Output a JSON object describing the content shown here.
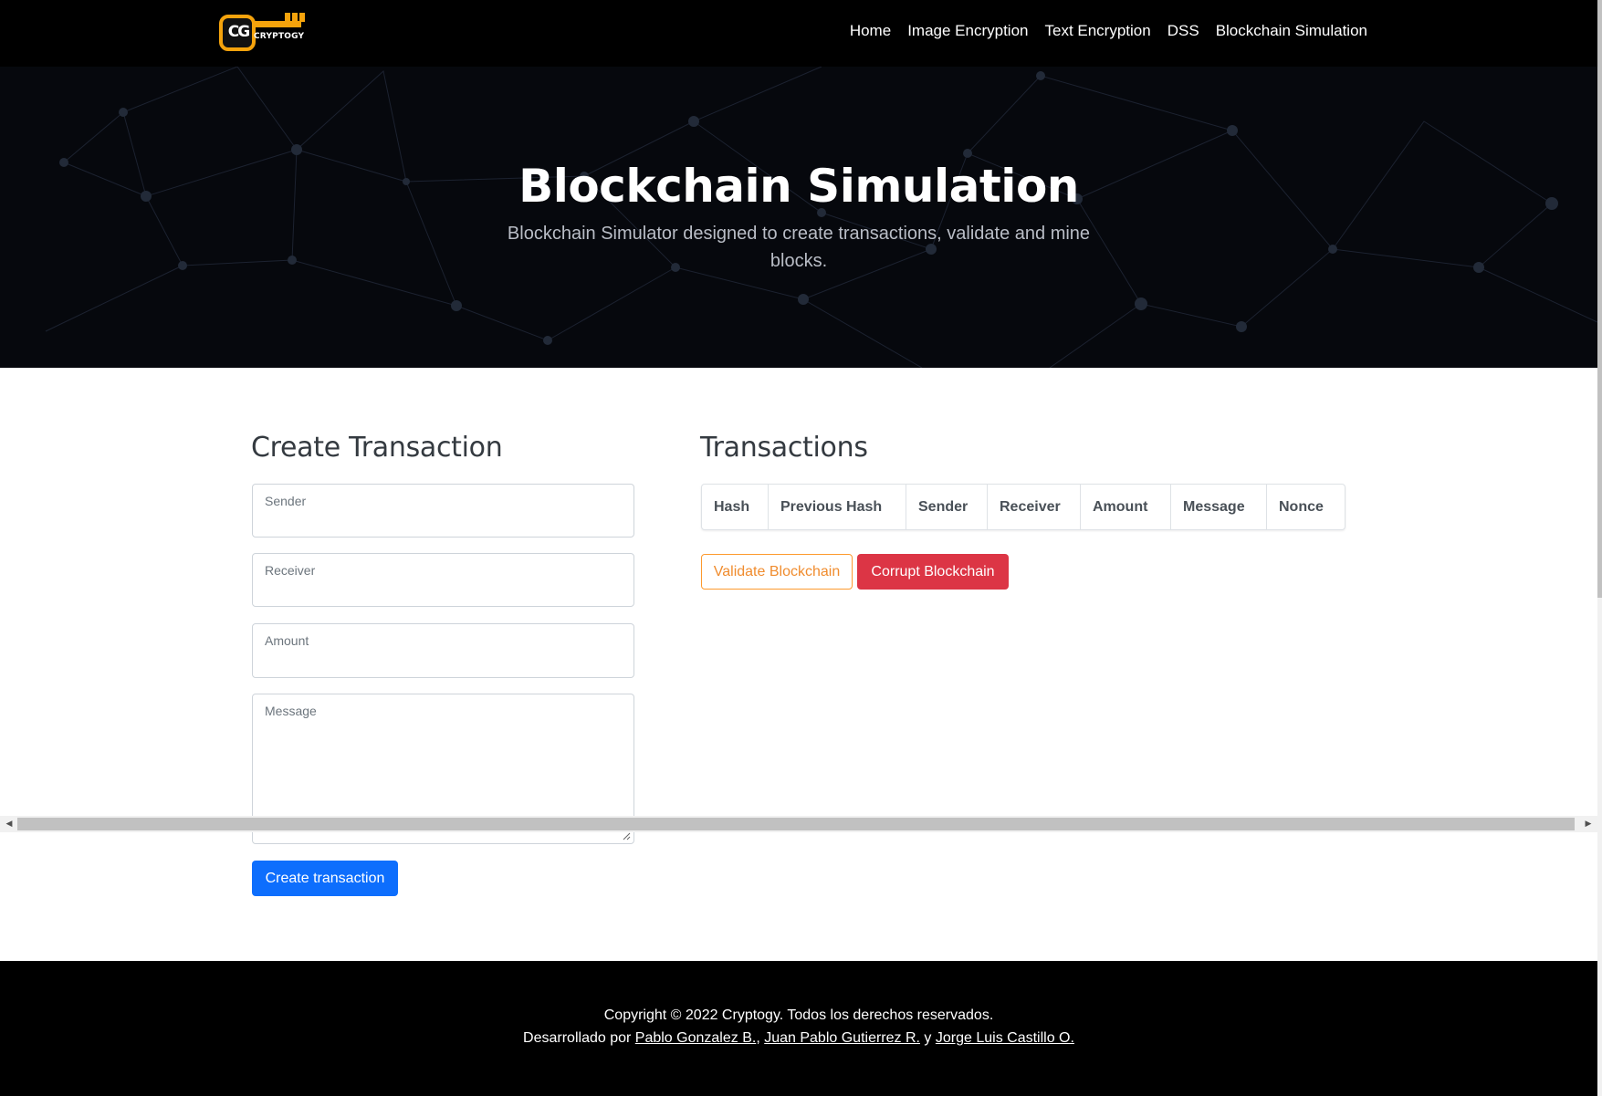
{
  "navbar": {
    "logo_text": "CRYPTOGY",
    "logo_mark": "CG",
    "links": [
      "Home",
      "Image Encryption",
      "Text Encryption",
      "DSS",
      "Blockchain Simulation"
    ]
  },
  "hero": {
    "title": "Blockchain Simulation",
    "subtitle": "Blockchain Simulator designed to create transactions, validate and mine blocks."
  },
  "create_transaction": {
    "title": "Create Transaction",
    "fields": {
      "sender": "Sender",
      "receiver": "Receiver",
      "amount": "Amount",
      "message": "Message"
    },
    "submit_label": "Create transaction"
  },
  "transactions": {
    "title": "Transactions",
    "columns": [
      "Hash",
      "Previous Hash",
      "Sender",
      "Receiver",
      "Amount",
      "Message",
      "Nonce"
    ],
    "validate_label": "Validate Blockchain",
    "corrupt_label": "Corrupt Blockchain"
  },
  "footer": {
    "copyright": "Copyright © 2022 Cryptogy. Todos los derechos reservados.",
    "dev_prefix": "Desarrollado por",
    "dev1": "Pablo Gonzalez B.",
    "sep1": ",",
    "dev2": "Juan Pablo Gutierrez R.",
    "sep2": "y",
    "dev3": "Jorge Luis Castillo O."
  },
  "colors": {
    "primary": "#0d6efd",
    "warning_outline": "#fd9a2e",
    "danger": "#dc3545",
    "logo_accent": "#f5a30c"
  }
}
